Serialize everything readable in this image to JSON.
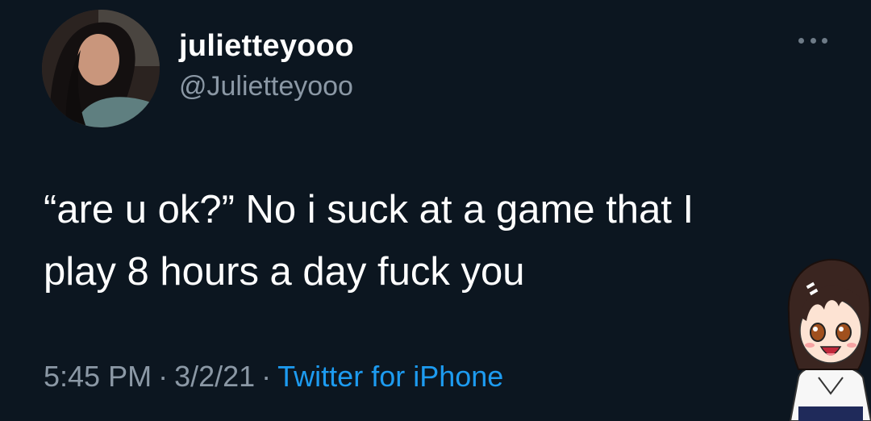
{
  "tweet": {
    "display_name": "juliettey​o​o​o",
    "handle": "@Juliettey​ooo",
    "text_line1": "“are u ok?” No i suck at a game that I",
    "text_line2": "play 8 hours a day fuck you",
    "time": "5:45 PM",
    "date": "3/2/21",
    "separator": "·",
    "source": "Twitter for iPhone"
  },
  "icons": {
    "more": "more-horizontal-icon",
    "avatar": "profile-photo",
    "sticker": "anime-girl-sticker"
  },
  "colors": {
    "background": "#0c1620",
    "primary_text": "#ffffff",
    "secondary_text": "#8b98a5",
    "link": "#1d9bf0"
  }
}
